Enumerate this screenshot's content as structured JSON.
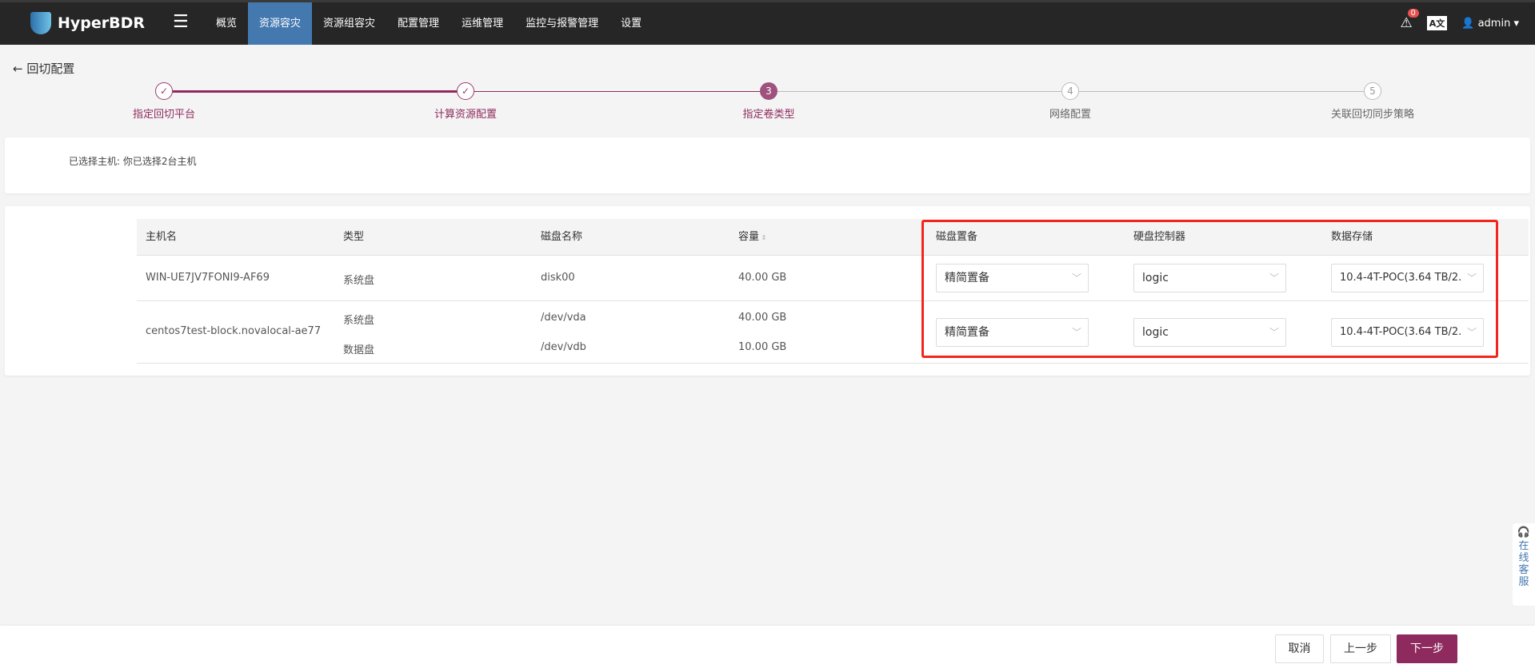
{
  "nav": {
    "brand": "HyperBDR",
    "menu": [
      "概览",
      "资源容灾",
      "资源组容灾",
      "配置管理",
      "运维管理",
      "监控与报警管理",
      "设置"
    ],
    "active_index": 1,
    "alert_count": "0",
    "lang_label": "A文",
    "user": "admin"
  },
  "page": {
    "title": "回切配置"
  },
  "steps": [
    {
      "num": "1",
      "label": "指定回切平台",
      "state": "done"
    },
    {
      "num": "2",
      "label": "计算资源配置",
      "state": "done"
    },
    {
      "num": "3",
      "label": "指定卷类型",
      "state": "current"
    },
    {
      "num": "4",
      "label": "网络配置",
      "state": "todo"
    },
    {
      "num": "5",
      "label": "关联回切同步策略",
      "state": "todo"
    }
  ],
  "selection": {
    "label": "已选择主机:",
    "value": "你已选择2台主机"
  },
  "table": {
    "headers": [
      "主机名",
      "类型",
      "磁盘名称",
      "容量",
      "磁盘置备",
      "硬盘控制器",
      "数据存储"
    ],
    "rows": [
      {
        "host": "WIN-UE7JV7FONI9-AF69",
        "disks": [
          {
            "type": "系统盘",
            "name": "disk00",
            "size": "40.00 GB"
          }
        ],
        "provision": "精简置备",
        "controller": "logic",
        "datastore": "10.4-4T-POC(3.64 TB/2."
      },
      {
        "host": "centos7test-block.novalocal-ae77",
        "disks": [
          {
            "type": "系统盘",
            "name": "/dev/vda",
            "size": "40.00 GB"
          },
          {
            "type": "数据盘",
            "name": "/dev/vdb",
            "size": "10.00 GB"
          }
        ],
        "provision": "精简置备",
        "controller": "logic",
        "datastore": "10.4-4T-POC(3.64 TB/2."
      }
    ]
  },
  "footer": {
    "cancel": "取消",
    "prev": "上一步",
    "next": "下一步"
  },
  "support": {
    "label": "在线客服"
  },
  "colors": {
    "accent": "#8e2a5e",
    "nav_active": "#4479b0",
    "highlight": "#f2261c"
  }
}
